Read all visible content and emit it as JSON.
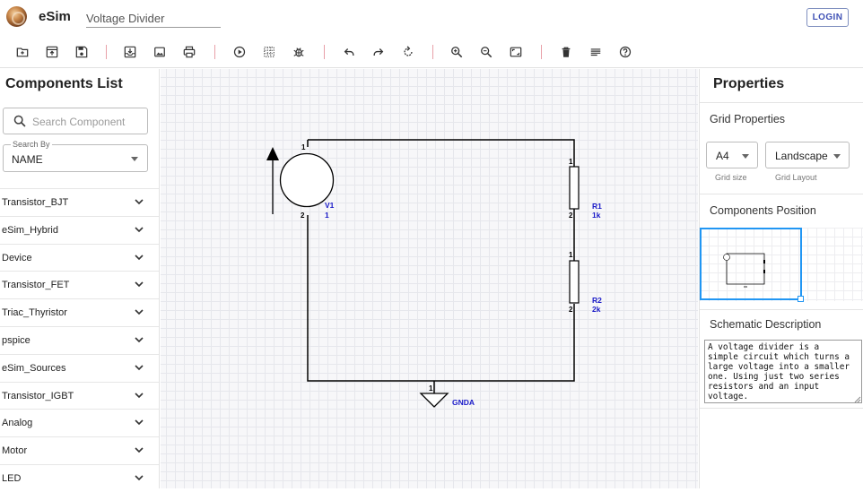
{
  "app": {
    "brand": "eSim",
    "title": "Voltage Divider",
    "login_label": "LOGIN"
  },
  "toolbar": {
    "icons": [
      "open-folder-icon",
      "upload-icon",
      "save-icon",
      "download-icon",
      "image-icon",
      "print-icon",
      "run-simulation-icon",
      "select-grid-icon",
      "debug-icon",
      "undo-icon",
      "redo-icon",
      "rotate-icon",
      "zoom-in-icon",
      "zoom-out-icon",
      "fit-screen-icon",
      "delete-icon",
      "netlist-icon",
      "help-icon"
    ]
  },
  "components_panel": {
    "title": "Components List",
    "search_placeholder": "Search Component",
    "search_by_label": "Search By",
    "search_by_value": "NAME",
    "categories": [
      "Transistor_BJT",
      "eSim_Hybrid",
      "Device",
      "Transistor_FET",
      "Triac_Thyristor",
      "pspice",
      "eSim_Sources",
      "Transistor_IGBT",
      "Analog",
      "Motor",
      "LED"
    ]
  },
  "schematic": {
    "source": {
      "ref": "V1",
      "value": "1",
      "pin1": "1",
      "pin2": "2"
    },
    "resistors": [
      {
        "ref": "R1",
        "value": "1k",
        "pin1": "1",
        "pin2": "2"
      },
      {
        "ref": "R2",
        "value": "2k",
        "pin1": "1",
        "pin2": "2"
      }
    ],
    "ground": {
      "label": "GNDA",
      "pin": "1"
    },
    "colors": {
      "wire": "#000000",
      "label": "#1a1ac8"
    }
  },
  "properties_panel": {
    "title": "Properties",
    "grid_properties_heading": "Grid Properties",
    "grid_size_value": "A4",
    "grid_size_help": "Grid size",
    "grid_layout_value": "Landscape",
    "grid_layout_help": "Grid Layout",
    "components_position_heading": "Components Position",
    "schematic_description_heading": "Schematic Description",
    "schematic_description": "A voltage divider is a\nsimple circuit which turns a\nlarge voltage into a smaller\none. Using just two series\nresistors and an input\nvoltage."
  },
  "colors": {
    "accent": "#3f51b5",
    "separator": "#e8a0a8",
    "minimap_viewport": "#2196f3"
  }
}
